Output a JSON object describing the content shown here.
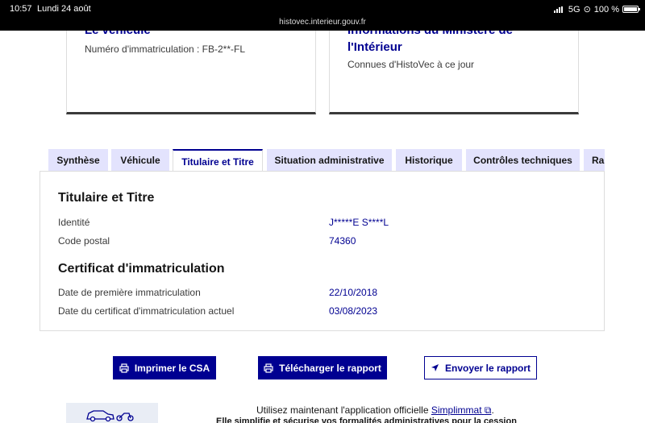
{
  "status_bar": {
    "time": "10:57",
    "date": "Lundi 24 août",
    "url": "histovec.interieur.gouv.fr",
    "network": "5G",
    "battery": "100 %"
  },
  "cards": {
    "vehicle": {
      "title": "Le véhicule",
      "text": "Numéro d'immatriculation : FB-2**-FL"
    },
    "ministry": {
      "title": "Informations du Ministère de l'Intérieur",
      "text": "Connues d'HistoVec à ce jour"
    }
  },
  "tabs": [
    {
      "label": "Synthèse",
      "active": false
    },
    {
      "label": "Véhicule",
      "active": false
    },
    {
      "label": "Titulaire et Titre",
      "active": true
    },
    {
      "label": "Situation administrative",
      "active": false
    },
    {
      "label": "Historique",
      "active": false
    },
    {
      "label": "Contrôles techniques",
      "active": false
    },
    {
      "label": "Rap",
      "active": false
    }
  ],
  "panel": {
    "holder_heading": "Titulaire et Titre",
    "identity_label": "Identité",
    "identity_value": "J*****E S****L",
    "postal_label": "Code postal",
    "postal_value": "74360",
    "certificate_heading": "Certificat d'immatriculation",
    "first_reg_label": "Date de première immatriculation",
    "first_reg_value": "22/10/2018",
    "current_cert_label": "Date du certificat d'immatriculation actuel",
    "current_cert_value": "03/08/2023"
  },
  "actions": {
    "print_label": "Imprimer le CSA",
    "download_label": "Télécharger le rapport",
    "send_label": "Envoyer le rapport"
  },
  "footer": {
    "text_prefix": "Utilisez maintenant l'application officielle",
    "link_label": "Simplimmat",
    "text_suffix": ".",
    "cut_text": "Elle simplifie et sécurise vos formalités administratives pour la cession"
  },
  "colors": {
    "primary": "#000091",
    "tab_bg": "#e3e3fd",
    "text": "#161616",
    "border": "#dddddd"
  }
}
